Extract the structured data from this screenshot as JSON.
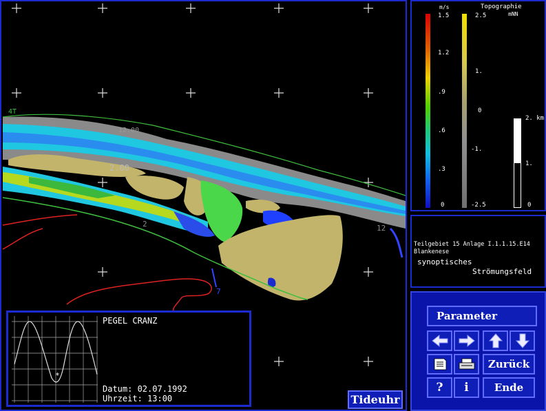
{
  "map": {
    "label_upper_left": "4T",
    "contour_label_a": "2.00",
    "contour_label_b": "12.00",
    "contour_label_c": "2",
    "contour_label_d": "12",
    "contour_label_e": "7"
  },
  "legend": {
    "speed_unit": "m/s",
    "speed_ticks": [
      "1.5",
      "1.2",
      ".9",
      ".6",
      ".3",
      "0"
    ],
    "topo_title": "Topographie",
    "topo_unit": "mNN",
    "topo_ticks": [
      "2.5",
      "1.",
      "0",
      "-1.",
      "-2.5"
    ],
    "scale_ticks": [
      "2. km",
      "1.",
      "0"
    ]
  },
  "info": {
    "line1": "Teilgebiet 15  Anlage I.1.1.15.E14",
    "line2": "Blankenese",
    "line3": "synoptisches",
    "line4": "Strömungsfeld"
  },
  "tide": {
    "title": "PEGEL CRANZ",
    "date": "Datum: 02.07.1992",
    "time": "Uhrzeit: 13:00",
    "button": "Tideuhr"
  },
  "nav": {
    "parameter": "Parameter",
    "zurueck": "Zurück",
    "help": "?",
    "info": "i",
    "ende": "Ende"
  },
  "colors": {
    "frame": "#1c2bd0",
    "button_bg": "#0f1eb6",
    "land": "#c2b46a",
    "water_shallow": "#00c8e0",
    "water_deep": "#2040ff"
  }
}
